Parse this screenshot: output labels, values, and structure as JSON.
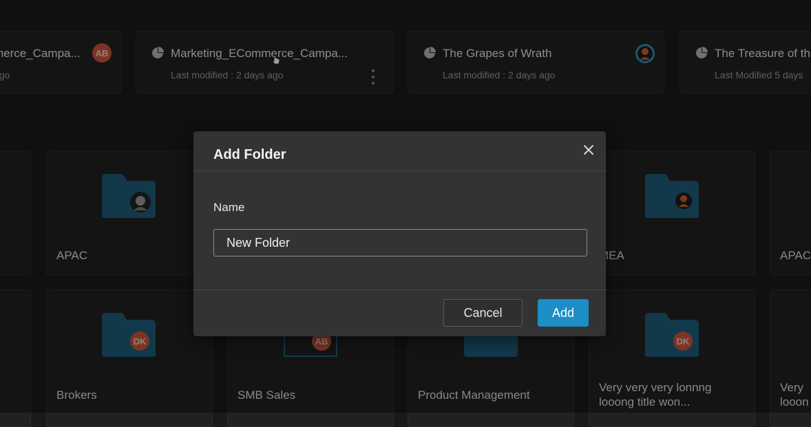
{
  "recent": [
    {
      "title": "merce_Campa...",
      "subtitle": "ago",
      "avatar": "AB"
    },
    {
      "title": "Marketing_ECommerce_Campa...",
      "subtitle": "Last modified : 2 days ago"
    },
    {
      "title": "The Grapes of Wrath",
      "subtitle": "Last modified : 2 days ago"
    },
    {
      "title": "The Treasure of th",
      "subtitle": "Last Modified 5 days"
    }
  ],
  "folders_row1": [
    {
      "label": "APAC"
    },
    {
      "label": "MEA"
    },
    {
      "label": "APAC"
    }
  ],
  "folders_row2": [
    {
      "label": "Brokers",
      "avatar": "DK"
    },
    {
      "label": "SMB Sales",
      "avatar": "AB"
    },
    {
      "label": "Product Management"
    },
    {
      "label": "Very very very lonnng looong title won...",
      "line1": "Very very very lonnng",
      "line2": "looong title won...",
      "avatar": "DK"
    },
    {
      "line1": "Very",
      "line2": "looon"
    }
  ],
  "dialog": {
    "title": "Add Folder",
    "name_label": "Name",
    "name_value": "New Folder",
    "cancel_label": "Cancel",
    "add_label": "Add"
  },
  "colors": {
    "folder": "#1d5d78",
    "accent": "#1b8fc6",
    "initials_avatar": "#c8553a"
  }
}
